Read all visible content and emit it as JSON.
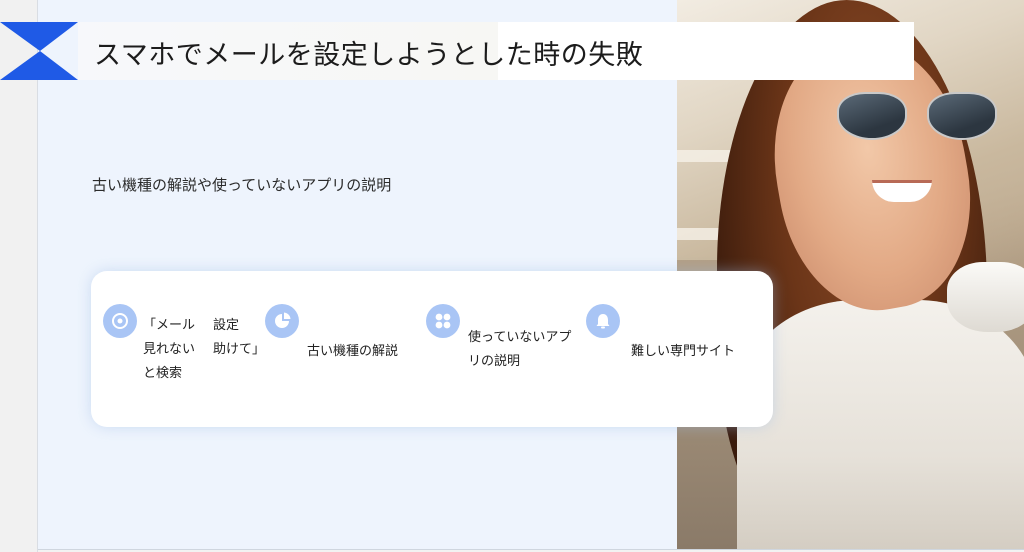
{
  "slide": {
    "title": "スマホでメールを設定しようとした時の失敗",
    "subtitle": "古い機種の解説や使っていないアプリの説明"
  },
  "card": {
    "items": [
      {
        "icon": "disc-icon",
        "text_line1": "「メール",
        "text_line2": "見れない",
        "text_line3": "と検索"
      },
      {
        "icon": "pie-chart-icon",
        "text_line1": "設定",
        "text_line2": "助けて」"
      },
      {
        "text": "古い機種の解説"
      },
      {
        "icon": "grid-icon",
        "text_line1": "使っていないアプ",
        "text_line2": "リの説明"
      },
      {
        "icon": "bell-icon",
        "text": "難しい専門サイト"
      }
    ]
  },
  "colors": {
    "accent": "#1f5ae6",
    "icon_bg": "#a9c5f5",
    "slide_bg": "#eef4fd"
  }
}
